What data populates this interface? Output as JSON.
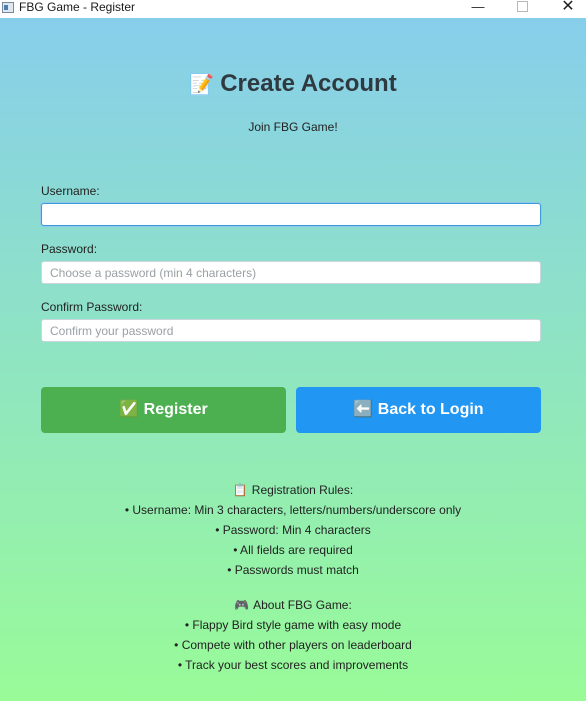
{
  "window": {
    "title": "FBG Game - Register",
    "minimize_label": "—",
    "maximize_icon": "maximize-icon",
    "close_label": "✕"
  },
  "header": {
    "icon": "📝",
    "title": "Create Account",
    "subtitle": "Join FBG Game!"
  },
  "form": {
    "username": {
      "label": "Username:",
      "value": "",
      "placeholder": ""
    },
    "password": {
      "label": "Password:",
      "value": "",
      "placeholder": "Choose a password (min 4 characters)"
    },
    "confirm": {
      "label": "Confirm Password:",
      "value": "",
      "placeholder": "Confirm your password"
    }
  },
  "buttons": {
    "register_label": "✅ Register",
    "back_label": "⬅️ Back to Login"
  },
  "rules": {
    "icon": "📋",
    "title": "Registration Rules:",
    "items": [
      "• Username: Min 3 characters, letters/numbers/underscore only",
      "• Password: Min 4 characters",
      "• All fields are required",
      "• Passwords must match"
    ]
  },
  "about": {
    "icon": "🎮",
    "title": "About FBG Game:",
    "items": [
      "• Flappy Bird style game with easy mode",
      "• Compete with other players on leaderboard",
      "• Track your best scores and improvements"
    ]
  },
  "colors": {
    "gradient_top": "#87ceeb",
    "gradient_bottom": "#98fb98",
    "register": "#4caf50",
    "back": "#2196f3"
  }
}
